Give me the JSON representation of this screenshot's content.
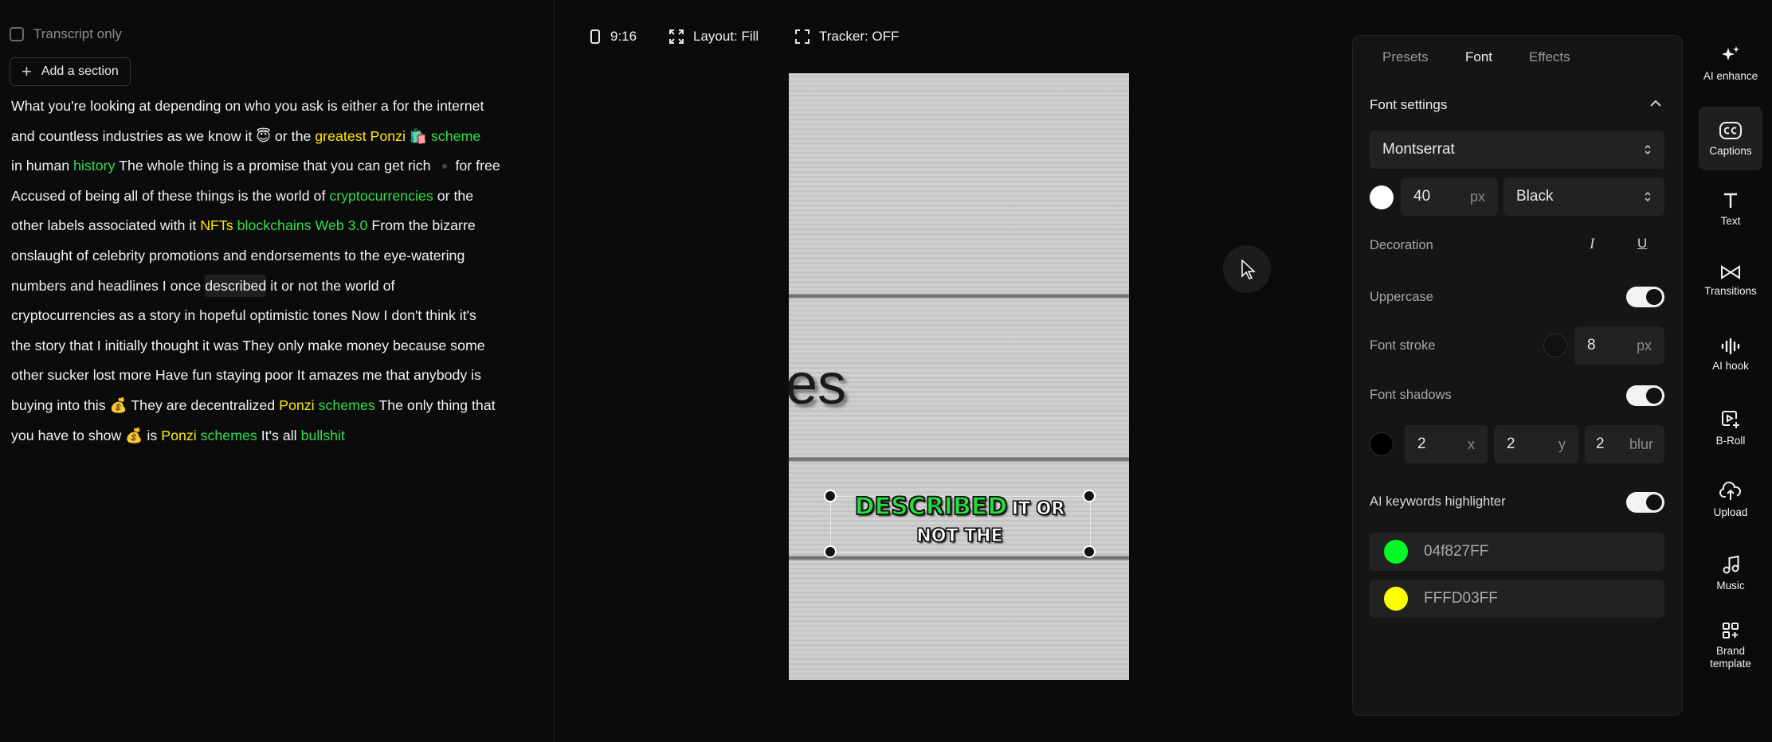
{
  "transcript": {
    "only_label": "Transcript only",
    "add_section": "Add a section",
    "lines": [
      [
        {
          "t": "What you're looking at depending on who you ask is either a for the internet"
        }
      ],
      [
        {
          "t": "and countless industries as we know it "
        },
        {
          "t": "😇"
        },
        {
          "t": "  or the "
        },
        {
          "t": "greatest Ponzi",
          "c": "y"
        },
        {
          "t": " "
        },
        {
          "t": "🛍️"
        },
        {
          "t": " "
        },
        {
          "t": "scheme",
          "c": "g"
        }
      ],
      [
        {
          "t": "in human "
        },
        {
          "t": "history",
          "c": "g"
        },
        {
          "t": " The whole thing is a promise that you can get rich "
        },
        {
          "t": "",
          "c": "dot"
        },
        {
          "t": "for free"
        }
      ],
      [
        {
          "t": "Accused of being all of these things is the world of "
        },
        {
          "t": "cryptocurrencies",
          "c": "g"
        },
        {
          "t": " or the"
        }
      ],
      [
        {
          "t": "other labels associated with it "
        },
        {
          "t": "NFTs",
          "c": "y"
        },
        {
          "t": " "
        },
        {
          "t": "blockchains Web 3.0",
          "c": "g"
        },
        {
          "t": " From the bizarre"
        }
      ],
      [
        {
          "t": "onslaught of celebrity promotions and endorsements to the eye-watering"
        }
      ],
      [
        {
          "t": "numbers and headlines I once "
        },
        {
          "t": "described",
          "c": "hl"
        },
        {
          "t": " it or not the world of"
        }
      ],
      [
        {
          "t": "cryptocurrencies as a story in hopeful optimistic tones Now I don't think it's"
        }
      ],
      [
        {
          "t": "the story that I initially thought it was They only make money because some"
        }
      ],
      [
        {
          "t": "other sucker lost more Have fun staying poor It amazes me that anybody is"
        }
      ],
      [
        {
          "t": "buying into this "
        },
        {
          "t": "💰"
        },
        {
          "t": "  They are decentralized "
        },
        {
          "t": "Ponzi",
          "c": "y"
        },
        {
          "t": " "
        },
        {
          "t": "schemes",
          "c": "g"
        },
        {
          "t": " The only thing that"
        }
      ],
      [
        {
          "t": "you have to show "
        },
        {
          "t": "💰"
        },
        {
          "t": "  is "
        },
        {
          "t": "Ponzi",
          "c": "y"
        },
        {
          "t": " "
        },
        {
          "t": "schemes",
          "c": "g"
        },
        {
          "t": " It's all "
        },
        {
          "t": "bullshit",
          "c": "g"
        }
      ]
    ]
  },
  "toolbar": {
    "ratio": "9:16",
    "layout": "Layout: Fill",
    "tracker": "Tracker: OFF"
  },
  "preview": {
    "frame_text": "es",
    "caption_highlight": "DESCRIBED",
    "caption_line1_rest": "IT OR",
    "caption_line2": "NOT THE"
  },
  "panel": {
    "tabs": [
      "Presets",
      "Font",
      "Effects"
    ],
    "active_tab": "Font",
    "section_title": "Font settings",
    "font_family": "Montserrat",
    "font_size": "40",
    "font_size_unit": "px",
    "font_weight": "Black",
    "font_color": "#ffffff",
    "decoration_label": "Decoration",
    "italic_glyph": "I",
    "underline_glyph": "U",
    "uppercase_label": "Uppercase",
    "uppercase_on": true,
    "stroke_label": "Font stroke",
    "stroke_color": "#111111",
    "stroke_value": "8",
    "stroke_unit": "px",
    "shadows_label": "Font shadows",
    "shadows_on": true,
    "shadow_color": "#000000",
    "shadow_x": "2",
    "shadow_x_unit": "x",
    "shadow_y": "2",
    "shadow_y_unit": "y",
    "shadow_blur": "2",
    "shadow_blur_unit": "blur",
    "keywords_label": "AI keywords highlighter",
    "keywords_on": true,
    "keyword_colors": [
      {
        "hex": "04f827FF",
        "swatch": "#04f827"
      },
      {
        "hex": "FFFD03FF",
        "swatch": "#fffd03"
      }
    ]
  },
  "rail": [
    {
      "label": "AI enhance",
      "icon": "sparkles-icon"
    },
    {
      "label": "Captions",
      "icon": "cc-icon",
      "active": true
    },
    {
      "label": "Text",
      "icon": "text-icon"
    },
    {
      "label": "Transitions",
      "icon": "transitions-icon"
    },
    {
      "label": "AI hook",
      "icon": "waveform-icon"
    },
    {
      "label": "B-Roll",
      "icon": "broll-icon"
    },
    {
      "label": "Upload",
      "icon": "upload-icon"
    },
    {
      "label": "Music",
      "icon": "music-icon"
    },
    {
      "label": "Brand\ntemplate",
      "icon": "brand-template-icon"
    }
  ]
}
